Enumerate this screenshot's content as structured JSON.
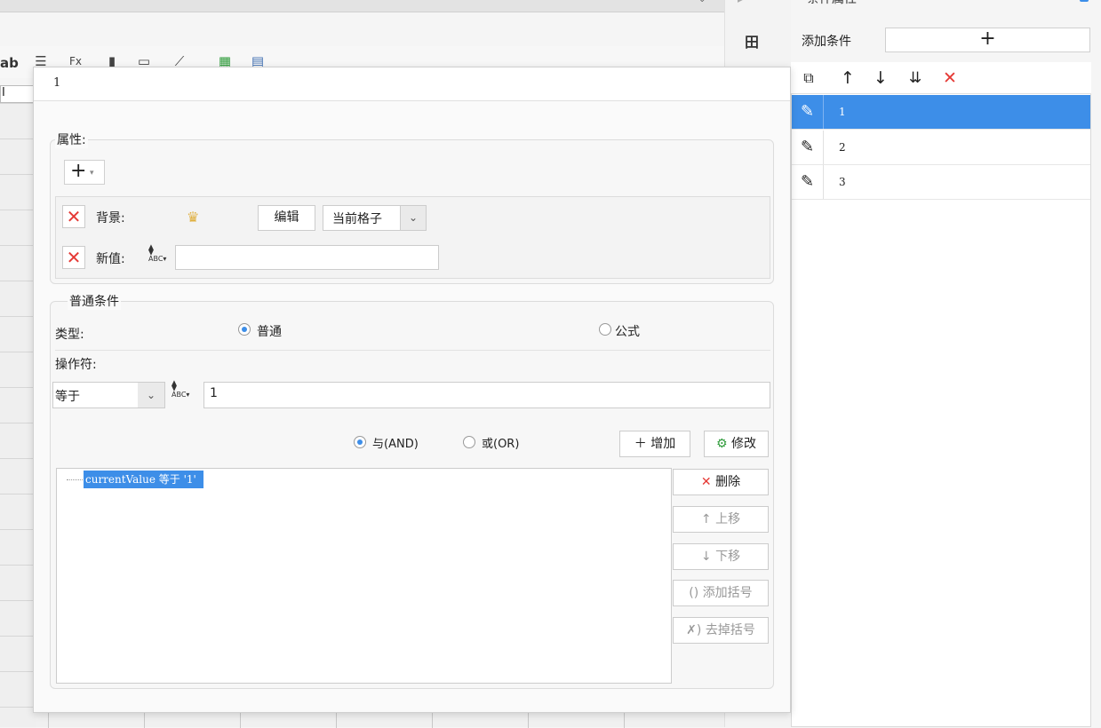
{
  "topbar": {
    "dropdown_icon": "chevron-down-icon"
  },
  "toolbar": {
    "lab_text": "ab",
    "fx_text": "Fx"
  },
  "grid": {
    "top_cell_text": "I"
  },
  "side_strip": {
    "icon": "layout-icon",
    "icon_glyph": "田"
  },
  "right_panel": {
    "title": "条件属性",
    "add_condition_label": "添加条件",
    "add_button_glyph": "+",
    "toolbar_icons": [
      "copy-icon",
      "arrow-up-icon",
      "arrow-down-icon",
      "move-bottom-icon",
      "delete-icon"
    ],
    "conditions": [
      {
        "label": "1",
        "selected": true
      },
      {
        "label": "2",
        "selected": false
      },
      {
        "label": "3",
        "selected": false
      }
    ]
  },
  "dialog": {
    "title": "1",
    "properties": {
      "label": "属性:",
      "add_glyph": "+",
      "background_label": "背景:",
      "edit_button": "编辑",
      "scope_value": "当前格子",
      "new_value_label": "新值:",
      "new_value_input": ""
    },
    "conditions": {
      "label": "普通条件",
      "type_label": "类型:",
      "type_normal": "普通",
      "type_formula": "公式",
      "type_selected": "普通",
      "operator_label": "操作符:",
      "operator_value": "等于",
      "operand_value": "1",
      "and_label": "与(AND)",
      "or_label": "或(OR)",
      "logic_selected": "AND",
      "add_button": "增加",
      "modify_button": "修改",
      "expression_items": [
        "currentValue 等于 '1'"
      ],
      "delete_button": "删除",
      "move_up_button": "上移",
      "move_down_button": "下移",
      "add_paren_button": "添加括号",
      "remove_paren_button": "去掉括号"
    }
  },
  "colors": {
    "accent": "#3d8ee8",
    "danger": "#e53935"
  }
}
